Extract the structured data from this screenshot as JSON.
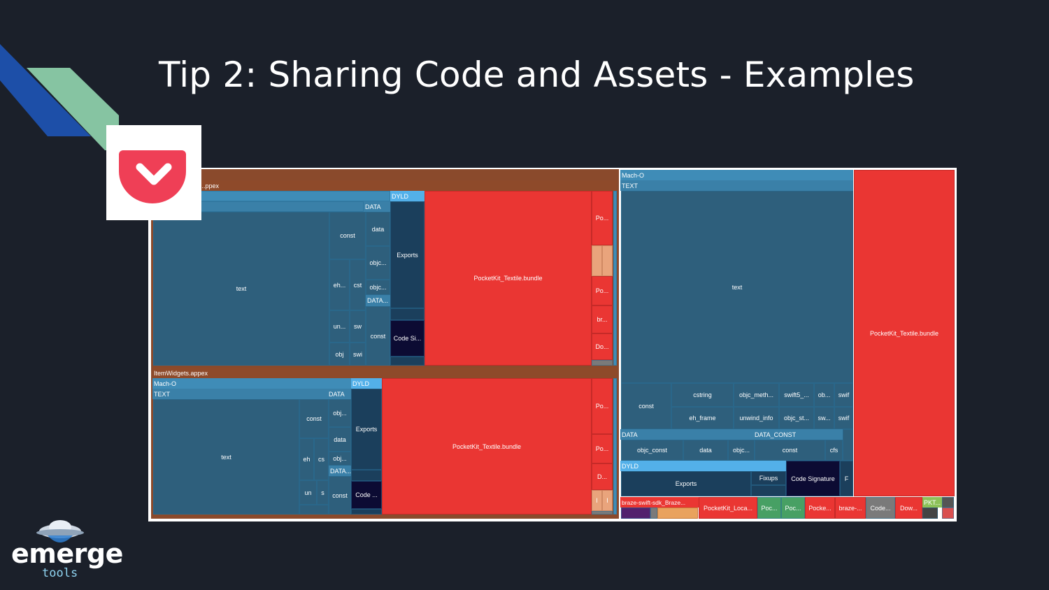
{
  "slide": {
    "title": "Tip 2: Sharing Code and Assets - Examples",
    "brand": {
      "word": "emerge",
      "sub": "tools"
    },
    "pocket_logo": "pocket-app-icon"
  },
  "treemap": {
    "left": {
      "top_appex": {
        "header": "...ppex",
        "dyld": "DYLD",
        "data": "DATA",
        "data_const": "DATA...",
        "cells": [
          "text",
          "const",
          "data",
          "objc...",
          "objc...",
          "eh...",
          "cst",
          "un...",
          "sw",
          "obj",
          "swi",
          "const",
          "Exports",
          "Code Si...",
          "PocketKit_Textile.bundle"
        ],
        "side": [
          "Po...",
          "Po...",
          "br...",
          "Do..."
        ]
      },
      "item_widgets": {
        "header": "ItemWidgets.appex",
        "mach_o": "Mach-O",
        "text_hdr": "TEXT",
        "data": "DATA",
        "dyld": "DYLD",
        "data_const": "DATA...",
        "cells": [
          "text",
          "const",
          "obj...",
          "data",
          "eh",
          "cs",
          "obj...",
          "un",
          "s",
          "const",
          "Exports",
          "Code ...",
          "PocketKit_Textile.bundle"
        ],
        "side": [
          "Po...",
          "Po...",
          "D...",
          "I",
          "I"
        ]
      }
    },
    "right": {
      "mach_o": "Mach-O",
      "text_hdr": "TEXT",
      "text": "text",
      "row1": [
        "const",
        "cstring",
        "objc_meth...",
        "swift5_...",
        "ob...",
        "swif"
      ],
      "row2": [
        "eh_frame",
        "unwind_info",
        "objc_st...",
        "sw...",
        "swif"
      ],
      "data": "DATA",
      "data_const": "DATA_CONST",
      "row3": [
        "objc_const",
        "data",
        "objc...",
        "const",
        "cfs"
      ],
      "dyld": "DYLD",
      "exports": "Exports",
      "fixups": "Fixups",
      "code_signature": "Code Signature",
      "f": "F",
      "bundle": "PocketKit_Textile.bundle",
      "bottom": [
        "braze-swift-sdk_Braze...",
        "PocketKit_Loca...",
        "Poc...",
        "Poc...",
        "Pocke...",
        "braze-...",
        "Code...",
        "Dow...",
        "PKT..."
      ]
    }
  }
}
